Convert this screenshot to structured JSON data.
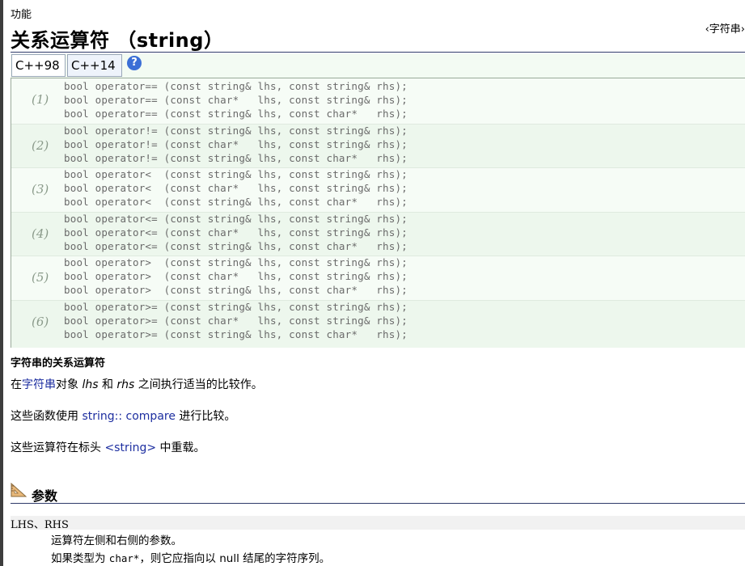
{
  "header": {
    "section_label": "功能",
    "title": "关系运算符 （string）",
    "header_link": "‹字符串›"
  },
  "tabs": [
    {
      "label": "C++98"
    },
    {
      "label": "C++14"
    }
  ],
  "help_icon": "?",
  "prototype_groups": [
    {
      "num": "(1)",
      "lines": [
        "bool operator== (const string& lhs, const string& rhs);",
        "bool operator== (const char*   lhs, const string& rhs);",
        "bool operator== (const string& lhs, const char*   rhs);"
      ]
    },
    {
      "num": "(2)",
      "lines": [
        "bool operator!= (const string& lhs, const string& rhs);",
        "bool operator!= (const char*   lhs, const string& rhs);",
        "bool operator!= (const string& lhs, const char*   rhs);"
      ]
    },
    {
      "num": "(3)",
      "lines": [
        "bool operator<  (const string& lhs, const string& rhs);",
        "bool operator<  (const char*   lhs, const string& rhs);",
        "bool operator<  (const string& lhs, const char*   rhs);"
      ]
    },
    {
      "num": "(4)",
      "lines": [
        "bool operator<= (const string& lhs, const string& rhs);",
        "bool operator<= (const char*   lhs, const string& rhs);",
        "bool operator<= (const string& lhs, const char*   rhs);"
      ]
    },
    {
      "num": "(5)",
      "lines": [
        "bool operator>  (const string& lhs, const string& rhs);",
        "bool operator>  (const char*   lhs, const string& rhs);",
        "bool operator>  (const string& lhs, const char*   rhs);"
      ]
    },
    {
      "num": "(6)",
      "lines": [
        "bool operator>= (const string& lhs, const string& rhs);",
        "bool operator>= (const char*   lhs, const string& rhs);",
        "bool operator>= (const string& lhs, const char*   rhs);"
      ]
    }
  ],
  "summary": "字符串的关系运算符",
  "desc1": {
    "prefix": "在",
    "link": "字符串",
    "mid1": "对象 ",
    "lhs": "lhs",
    "mid2": " 和 ",
    "rhs": "rhs",
    "suffix": " 之间执行适当的比较作。"
  },
  "desc2": {
    "prefix": "这些函数使用 ",
    "link": "string:: compare",
    "suffix": " 进行比较。"
  },
  "desc3": {
    "prefix": "这些运算符在标头 ",
    "link": "<string>",
    "suffix": " 中重载。"
  },
  "params": {
    "heading": "参数",
    "icon": "ruler-triangle-icon",
    "term": "LHS、RHS",
    "desc_line1": "运算符左侧和右侧的参数。",
    "desc_line2_prefix": "如果类型为 ",
    "desc_line2_code": "char*",
    "desc_line2_suffix": "，则它应指向以 null 结尾的字符序列。"
  },
  "colors": {
    "link": "#1d2ea0",
    "rule": "#2f3b6a",
    "proto_bg": "#f6fcf6",
    "proto_bg_alt": "#edf7ed",
    "proto_text": "#6a6a6a"
  }
}
